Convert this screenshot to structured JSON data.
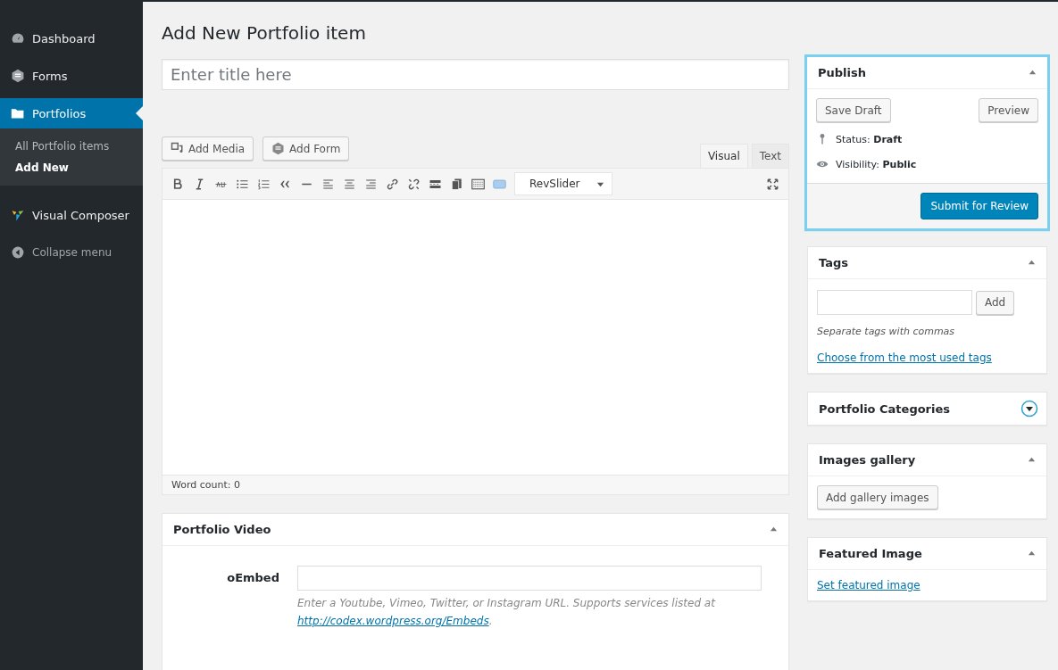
{
  "sidebar": {
    "items": [
      {
        "label": "Dashboard",
        "selected": false
      },
      {
        "label": "Forms",
        "selected": false
      },
      {
        "label": "Portfolios",
        "selected": true,
        "children": [
          {
            "label": "All Portfolio items",
            "selected": false
          },
          {
            "label": "Add New",
            "selected": true
          }
        ]
      },
      {
        "label": "Visual Composer",
        "selected": false
      }
    ],
    "collapse": "Collapse menu"
  },
  "page_title": "Add New Portfolio item",
  "title_field": {
    "placeholder": "Enter title here"
  },
  "editor": {
    "media_buttons": [
      {
        "label": "Add Media"
      },
      {
        "label": "Add Form"
      }
    ],
    "tabs": [
      {
        "label": "Visual",
        "selected": true
      },
      {
        "label": "Text",
        "selected": false
      }
    ],
    "dropdown": "RevSlider",
    "word_count": "Word count: 0"
  },
  "portfolio_video": {
    "title": "Portfolio Video",
    "expanded": true,
    "label": "oEmbed",
    "help": "Enter a Youtube, Vimeo, Twitter, or Instagram URL. Supports services listed at",
    "link": "http://codex.wordpress.org/Embeds",
    "after_link": "."
  },
  "publish": {
    "title": "Publish",
    "expanded": true,
    "highlighted": true,
    "save": "Save Draft",
    "preview": "Preview",
    "status": "Status: **Draft**",
    "visibility": "Visibility: **Public**",
    "submit": "Submit for Review"
  },
  "tags": {
    "title": "Tags",
    "expanded": true,
    "add": "Add",
    "hint": "Separate tags with commas",
    "link": "Choose from the most used tags"
  },
  "categories": {
    "title": "Portfolio Categories",
    "expanded": false
  },
  "gallery": {
    "title": "Images gallery",
    "expanded": true,
    "button": "Add gallery images"
  },
  "featured": {
    "title": "Featured Image",
    "expanded": true,
    "link": "Set featured image"
  }
}
